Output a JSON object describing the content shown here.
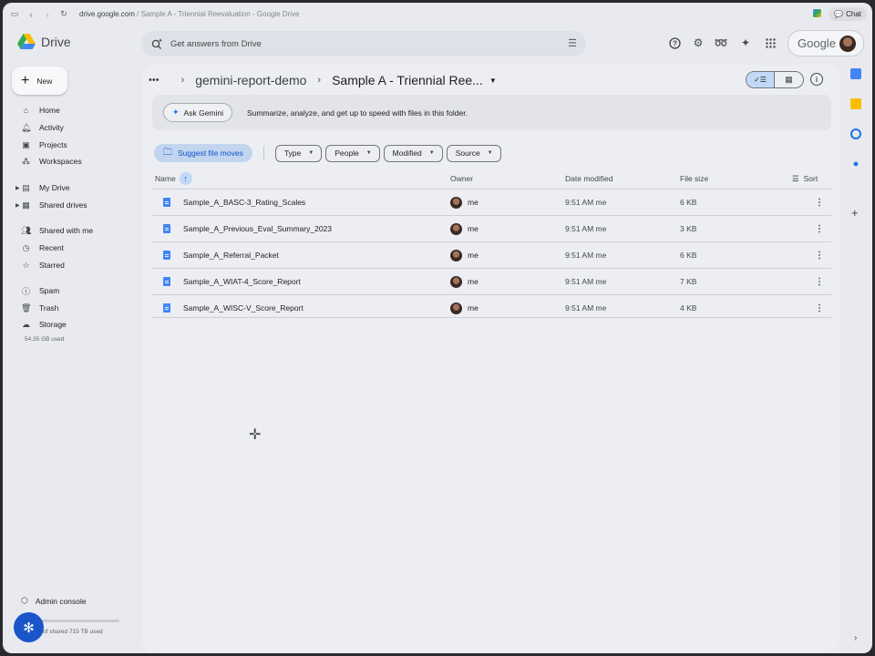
{
  "browser": {
    "url_host": "drive.google.com",
    "url_rest": " / Sample A - Triennial Reevaluation - Google Drive",
    "chat_label": "Chat"
  },
  "header": {
    "app_name": "Drive",
    "search_placeholder": "Get answers from Drive",
    "account_brand": "Google"
  },
  "sidebar": {
    "new_label": "New",
    "items": [
      {
        "label": "Home",
        "icon": "home-icon"
      },
      {
        "label": "Activity",
        "icon": "bell-icon"
      },
      {
        "label": "Projects",
        "icon": "projects-icon"
      },
      {
        "label": "Workspaces",
        "icon": "workspaces-icon"
      },
      {
        "label": "My Drive",
        "icon": "my-drive-icon"
      },
      {
        "label": "Shared drives",
        "icon": "shared-drives-icon"
      },
      {
        "label": "Shared with me",
        "icon": "people-icon"
      },
      {
        "label": "Recent",
        "icon": "clock-icon"
      },
      {
        "label": "Starred",
        "icon": "star-icon"
      },
      {
        "label": "Spam",
        "icon": "spam-icon"
      },
      {
        "label": "Trash",
        "icon": "trash-icon"
      },
      {
        "label": "Storage",
        "icon": "cloud-icon"
      }
    ],
    "storage_used": "54.35 GB used",
    "admin_label": "Admin console",
    "shared_storage": "of shared 715 TB used"
  },
  "breadcrumb": {
    "parent": "gemini-report-demo",
    "current": "Sample A - Triennial Ree..."
  },
  "gemini": {
    "ask_label": "Ask Gemini",
    "banner_text": "Summarize, analyze, and get up to speed with files in this folder."
  },
  "filters": {
    "suggest_label": "Suggest file moves",
    "chips": [
      "Type",
      "People",
      "Modified",
      "Source"
    ]
  },
  "table": {
    "headers": {
      "name": "Name",
      "owner": "Owner",
      "date": "Date modified",
      "size": "File size",
      "sort": "Sort"
    },
    "rows": [
      {
        "name": "Sample_A_BASC-3_Rating_Scales",
        "owner": "me",
        "date": "9:51 AM me",
        "size": "6 KB"
      },
      {
        "name": "Sample_A_Previous_Eval_Summary_2023",
        "owner": "me",
        "date": "9:51 AM me",
        "size": "3 KB"
      },
      {
        "name": "Sample_A_Referral_Packet",
        "owner": "me",
        "date": "9:51 AM me",
        "size": "6 KB"
      },
      {
        "name": "Sample_A_WIAT-4_Score_Report",
        "owner": "me",
        "date": "9:51 AM me",
        "size": "7 KB"
      },
      {
        "name": "Sample_A_WISC-V_Score_Report",
        "owner": "me",
        "date": "9:51 AM me",
        "size": "4 KB"
      }
    ]
  },
  "colors": {
    "accent": "#0b57d0",
    "doc_blue": "#4285f4",
    "selected_bg": "#c2d8f5"
  }
}
